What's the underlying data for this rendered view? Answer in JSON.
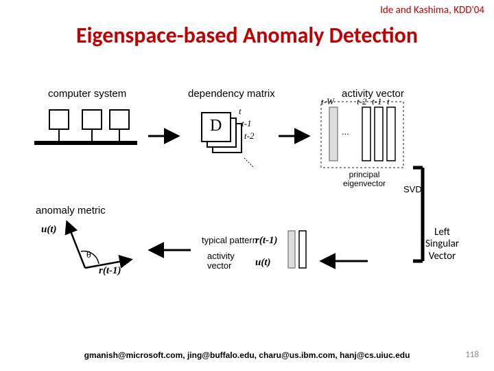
{
  "citation": "Ide and Kashima, KDD'04",
  "title": "Eigenspace-based Anomaly Detection",
  "labels": {
    "computer_system": "computer system",
    "dependency_matrix": "dependency matrix",
    "activity_vector": "activity vector",
    "anomaly_metric": "anomaly metric",
    "typical_pattern": "typical pattern",
    "activity_vector2": "activity\nvector",
    "principal_eigenvector": "principal\neigenvector",
    "D": "D",
    "t": "t",
    "t1": "t-1",
    "t2": "t-2",
    "tW": "t-W",
    "t2b": "t-2",
    "t1b": "t-1",
    "tb": "t",
    "dots": "...",
    "svd": "SVD",
    "ut": "u(t)",
    "ut2": "u(t)",
    "rt1": "r(t-1)",
    "rt1b": "r(t-1)",
    "theta": "θ"
  },
  "annotation": "Left\nSingular\nVector",
  "footer": "gmanish@microsoft.com, jing@buffalo.edu, charu@us.ibm.com, hanj@cs.uiuc.edu",
  "page": "118"
}
